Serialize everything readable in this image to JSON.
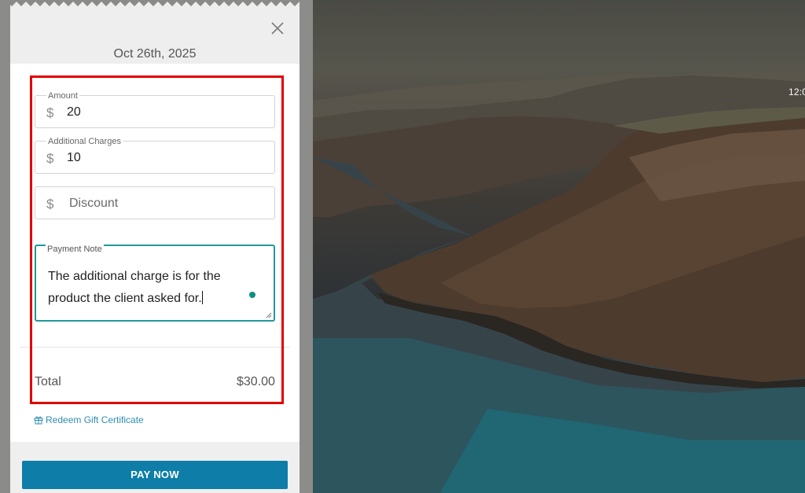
{
  "background": {
    "clock_text": "12:0"
  },
  "panel": {
    "date": "Oct 26th, 2025",
    "close_icon": "close-icon",
    "fields": {
      "amount": {
        "label": "Amount",
        "currency": "$",
        "value": "20"
      },
      "additional_charges": {
        "label": "Additional Charges",
        "currency": "$",
        "value": "10"
      },
      "discount": {
        "currency": "$",
        "placeholder": "Discount"
      }
    },
    "payment_note": {
      "label": "Payment Note",
      "value": "The additional charge is for the product the client asked for."
    },
    "total": {
      "label": "Total",
      "value": "$30.00"
    },
    "gift_link": {
      "icon": "gift-icon",
      "label": "Redeem Gift Certificate"
    },
    "pay_button": "PAY NOW"
  },
  "colors": {
    "highlight_outline": "#e10000",
    "pay_button": "#0e7ea8",
    "note_border": "#21989a",
    "link": "#2f8eb1"
  }
}
